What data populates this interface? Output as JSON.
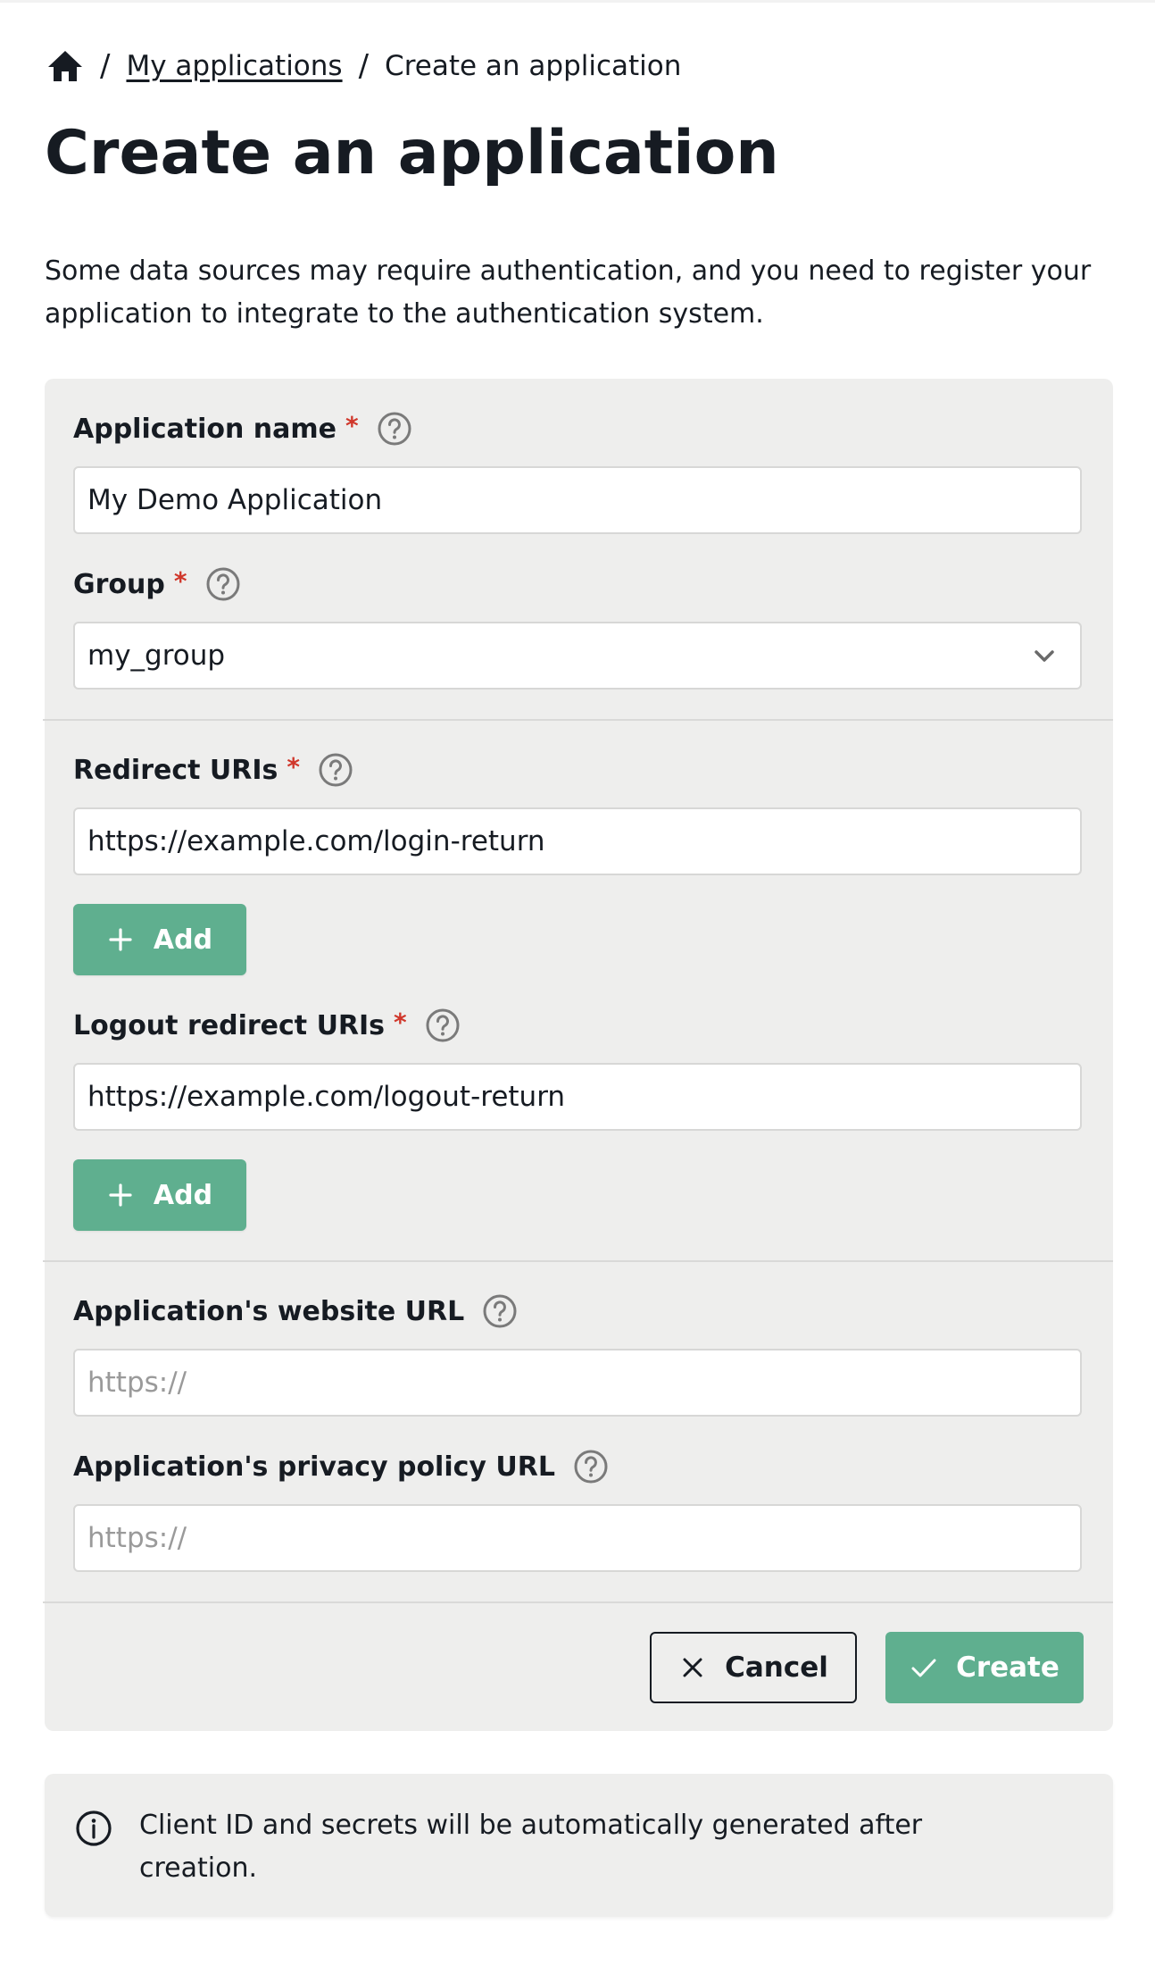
{
  "breadcrumb": {
    "home_icon": "home-icon",
    "separator": "/",
    "items": [
      {
        "label": "My applications",
        "link": true
      },
      {
        "label": "Create an application",
        "link": false
      }
    ]
  },
  "page": {
    "title": "Create an application",
    "intro": "Some data sources may require authentication, and you need to register your application to integrate to the authentication system."
  },
  "form": {
    "required_marker": "*",
    "help_icon": "question-circle-icon",
    "fields": {
      "app_name": {
        "label": "Application name",
        "required": true,
        "value": "My Demo Application"
      },
      "group": {
        "label": "Group",
        "required": true,
        "value": "my_group",
        "icon": "chevron-down-icon"
      },
      "redirect_uris": {
        "label": "Redirect URIs",
        "required": true,
        "value": "https://example.com/login-return",
        "add_label": "Add"
      },
      "logout_redirect_uris": {
        "label": "Logout redirect URIs",
        "required": true,
        "value": "https://example.com/logout-return",
        "add_label": "Add"
      },
      "website_url": {
        "label": "Application's website URL",
        "required": false,
        "value": "",
        "placeholder": "https://"
      },
      "privacy_url": {
        "label": "Application's privacy policy URL",
        "required": false,
        "value": "",
        "placeholder": "https://"
      }
    },
    "actions": {
      "cancel_label": "Cancel",
      "create_label": "Create"
    }
  },
  "notice": {
    "icon": "info-icon",
    "text": "Client ID and secrets will be automatically generated after creation."
  },
  "colors": {
    "accent": "#5faf8f",
    "required": "#d0372b",
    "panel_bg": "#eeeeed",
    "text": "#161b22",
    "help_icon": "#7a7a7a"
  }
}
